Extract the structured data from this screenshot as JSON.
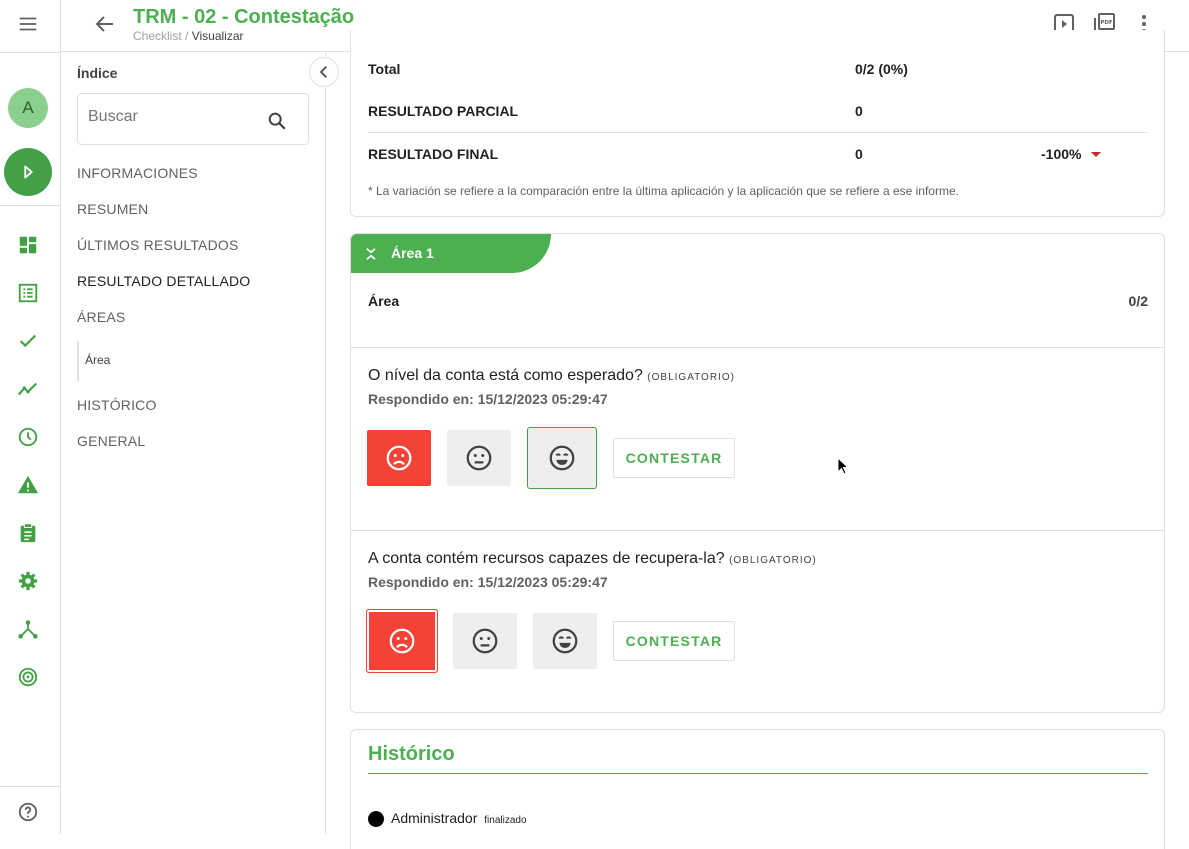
{
  "header": {
    "title": "TRM - 02 - Contestação",
    "breadcrumb_parent": "Checklist",
    "breadcrumb_sep": " / ",
    "breadcrumb_current": "Visualizar"
  },
  "rail": {
    "avatar_letter": "A",
    "icons": [
      "menu-icon",
      "dashboard-icon",
      "list-icon",
      "check-icon",
      "trending-icon",
      "clock-icon",
      "warning-icon",
      "clipboard-icon",
      "gear-icon",
      "hierarchy-icon",
      "target-icon",
      "help-icon"
    ]
  },
  "index": {
    "title": "Índice",
    "search_placeholder": "Buscar",
    "items": [
      "INFORMACIONES",
      "RESUMEN",
      "ÚLTIMOS RESULTADOS",
      "RESULTADO DETALLADO",
      "ÁREAS",
      "HISTÓRICO",
      "GENERAL"
    ],
    "sub_item": "Área"
  },
  "summary": {
    "total_label": "Total",
    "total_value": "0/2 (0%)",
    "partial_label": "RESULTADO PARCIAL",
    "partial_value": "0",
    "final_label": "RESULTADO FINAL",
    "final_value": "0",
    "final_variation": "-100%",
    "footnote": "* La variación se refiere a la comparación entre la última aplicación y la aplicación que se refiere a ese informe."
  },
  "area": {
    "tab_label": "Área 1",
    "row_label": "Área",
    "row_score": "0/2",
    "questions": [
      {
        "text": "O nível da conta está como esperado?",
        "tag": "(OBLIGATORIO)",
        "answered": "Respondido en: 15/12/2023 05:29:47",
        "contest_label": "CONTESTAR"
      },
      {
        "text": "A conta contém recursos capazes de recupera-la?",
        "tag": "(OBLIGATORIO)",
        "answered": "Respondido en: 15/12/2023 05:29:47",
        "contest_label": "CONTESTAR"
      }
    ]
  },
  "history": {
    "title": "Histórico",
    "entry_user": "Administrador",
    "entry_status": "finalizado"
  },
  "colors": {
    "brand_green": "#4caf50",
    "sad_red": "#f44336",
    "variation_down": "#c62828"
  }
}
